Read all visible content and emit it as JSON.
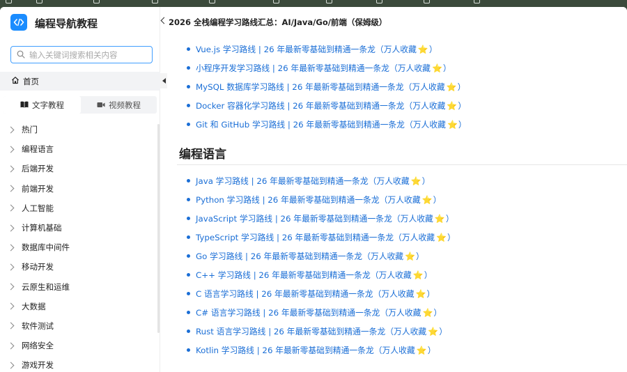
{
  "sidebar": {
    "site_title": "编程导航教程",
    "search_placeholder": "输入关键词搜索相关内容",
    "home_label": "首页",
    "tabs": [
      {
        "label": "文字教程",
        "active": true
      },
      {
        "label": "视频教程",
        "active": false
      }
    ],
    "items": [
      {
        "label": "热门"
      },
      {
        "label": "编程语言"
      },
      {
        "label": "后端开发"
      },
      {
        "label": "前端开发"
      },
      {
        "label": "人工智能"
      },
      {
        "label": "计算机基础"
      },
      {
        "label": "数据库中间件"
      },
      {
        "label": "移动开发"
      },
      {
        "label": "云原生和运维"
      },
      {
        "label": "大数据"
      },
      {
        "label": "软件测试"
      },
      {
        "label": "网络安全"
      },
      {
        "label": "游戏开发"
      }
    ]
  },
  "header": {
    "title": "2026 全栈编程学习路线汇总：AI/Java/Go/前端（保姆级）"
  },
  "content": {
    "top_links": [
      {
        "text": "Vue.js 学习路线 | 26 年最新零基础到精通一条龙（万人收藏"
      },
      {
        "text": "小程序开发学习路线 | 26 年最新零基础到精通一条龙（万人收藏"
      },
      {
        "text": "MySQL 数据库学习路线 | 26 年最新零基础到精通一条龙（万人收藏"
      },
      {
        "text": "Docker 容器化学习路线 | 26 年最新零基础到精通一条龙（万人收藏"
      },
      {
        "text": "Git 和 GitHub 学习路线 | 26 年最新零基础到精通一条龙（万人收藏"
      }
    ],
    "section_heading": "编程语言",
    "section_links": [
      {
        "text": "Java 学习路线 | 26 年最新零基础到精通一条龙（万人收藏"
      },
      {
        "text": "Python 学习路线 | 26 年最新零基础到精通一条龙（万人收藏"
      },
      {
        "text": "JavaScript 学习路线 | 26 年最新零基础到精通一条龙（万人收藏"
      },
      {
        "text": "TypeScript 学习路线 | 26 年最新零基础到精通一条龙（万人收藏"
      },
      {
        "text": "Go 学习路线 | 26 年最新零基础到精通一条龙（万人收藏"
      },
      {
        "text": "C++ 学习路线 | 26 年最新零基础到精通一条龙（万人收藏"
      },
      {
        "text": "C 语言学习路线 | 26 年最新零基础到精通一条龙（万人收藏"
      },
      {
        "text": "C# 语言学习路线 | 26 年最新零基础到精通一条龙（万人收藏"
      },
      {
        "text": "Rust 语言学习路线 | 26 年最新零基础到精通一条龙（万人收藏"
      },
      {
        "text": "Kotlin 学习路线 | 26 年最新零基础到精通一条龙（万人收藏"
      }
    ],
    "star_glyph": "⭐",
    "close_paren": "）"
  },
  "colors": {
    "accent": "#1a8cff",
    "link": "#1a6ed6",
    "star": "#f5b400"
  }
}
